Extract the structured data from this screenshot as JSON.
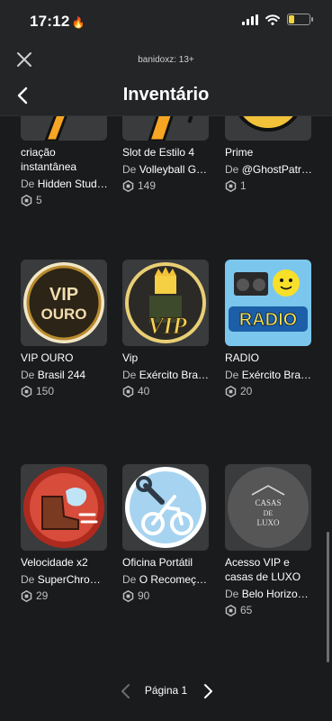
{
  "status_bar": {
    "time": "17:12",
    "battery_level": 0.25,
    "battery_color": "#f2d53c"
  },
  "web_header": {
    "account_label": "banidoxz: 13+"
  },
  "nav": {
    "title": "Inventário"
  },
  "labels": {
    "creator_prefix": "De"
  },
  "items": [
    {
      "name": "criação instantânea",
      "creator": "Hidden Stud…",
      "price": "5"
    },
    {
      "name": "Slot de Estilo 4",
      "creator": "Volleyball G…",
      "price": "149"
    },
    {
      "name": "Prime",
      "creator": "@GhostPatr…",
      "price": "1"
    },
    {
      "name": "VIP OURO",
      "creator": "Brasil 244",
      "price": "150",
      "thumb_text": [
        "VIP",
        "OURO"
      ]
    },
    {
      "name": "Vip",
      "creator": "Exército Bra…",
      "price": "40",
      "thumb_text": [
        "VIP"
      ]
    },
    {
      "name": "RADIO",
      "creator": "Exército Bra…",
      "price": "20",
      "thumb_text": [
        "RADIO"
      ]
    },
    {
      "name": "Velocidade x2",
      "creator": "SuperChro…",
      "price": "29"
    },
    {
      "name": "Oficina Portátil",
      "creator": "O Recomeç…",
      "price": "90"
    },
    {
      "name": "Acesso VIP e casas de LUXO",
      "creator": "Belo Horizo…",
      "price": "65",
      "thumb_text": [
        "CASAS",
        "DE",
        "LUXO"
      ]
    }
  ],
  "pagination": {
    "label": "Página 1"
  },
  "colors": {
    "background": "#191b1d",
    "header": "#232527",
    "card": "#393b3d",
    "muted_text": "#bdbebe"
  }
}
